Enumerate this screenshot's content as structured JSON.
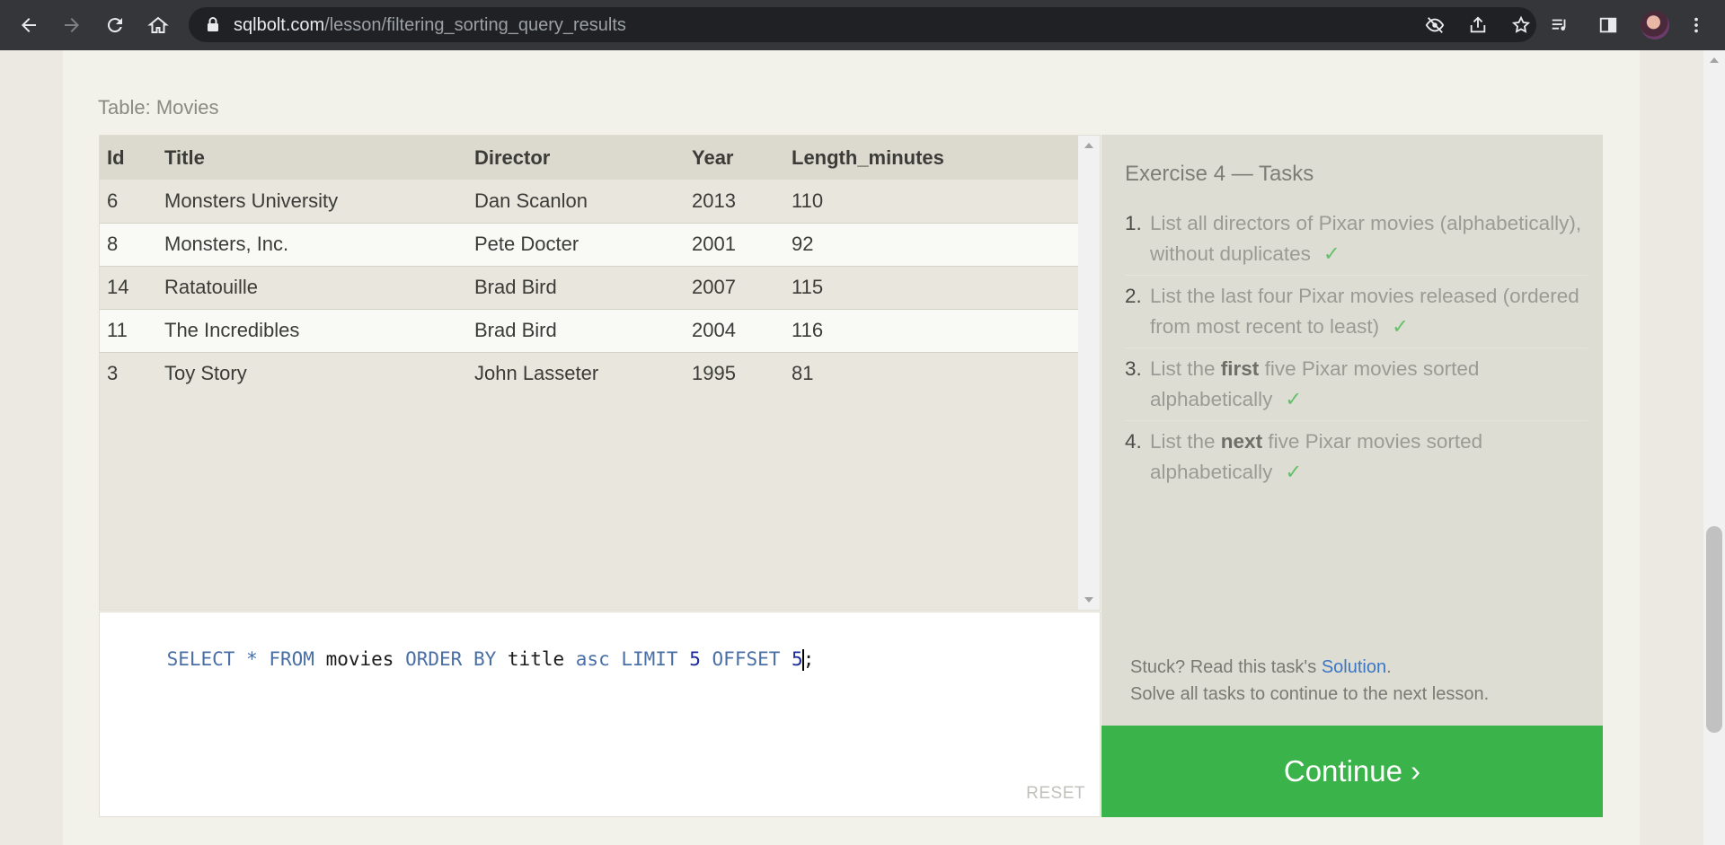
{
  "browser": {
    "url_host": "sqlbolt.com",
    "url_path": "/lesson/filtering_sorting_query_results"
  },
  "table": {
    "caption": "Table: Movies",
    "columns": [
      "Id",
      "Title",
      "Director",
      "Year",
      "Length_minutes"
    ],
    "rows": [
      [
        "6",
        "Monsters University",
        "Dan Scanlon",
        "2013",
        "110"
      ],
      [
        "8",
        "Monsters, Inc.",
        "Pete Docter",
        "2001",
        "92"
      ],
      [
        "14",
        "Ratatouille",
        "Brad Bird",
        "2007",
        "115"
      ],
      [
        "11",
        "The Incredibles",
        "Brad Bird",
        "2004",
        "116"
      ],
      [
        "3",
        "Toy Story",
        "John Lasseter",
        "1995",
        "81"
      ]
    ]
  },
  "editor": {
    "tokens": [
      {
        "t": "SELECT",
        "c": "kw"
      },
      {
        "t": " * ",
        "c": "punc"
      },
      {
        "t": "FROM",
        "c": "kw"
      },
      {
        "t": " movies ",
        "c": "id"
      },
      {
        "t": "ORDER BY",
        "c": "kw"
      },
      {
        "t": " title ",
        "c": "id"
      },
      {
        "t": "asc",
        "c": "kw"
      },
      {
        "t": " LIMIT ",
        "c": "kw"
      },
      {
        "t": "5",
        "c": "num"
      },
      {
        "t": " OFFSET ",
        "c": "kw"
      },
      {
        "t": "5",
        "c": "num"
      },
      {
        "t": ";",
        "c": "id"
      }
    ],
    "reset_label": "RESET"
  },
  "exercise": {
    "title": "Exercise 4 — Tasks",
    "tasks": [
      {
        "num": "1.",
        "parts": [
          "List all directors of Pixar movies (alphabetically), without duplicates"
        ],
        "bold": "",
        "done": "✓"
      },
      {
        "num": "2.",
        "parts": [
          "List the last four Pixar movies released (ordered from most recent to least)"
        ],
        "bold": "",
        "done": "✓"
      },
      {
        "num": "3.",
        "before": "List the ",
        "bold": "first",
        "after": " five Pixar movies sorted alphabetically",
        "done": "✓"
      },
      {
        "num": "4.",
        "before": "List the ",
        "bold": "next",
        "after": " five Pixar movies sorted alphabetically",
        "done": "✓"
      }
    ],
    "stuck_prefix": "Stuck? Read this task's ",
    "solution_link": "Solution",
    "stuck_suffix": ".",
    "stuck_line2": "Solve all tasks to continue to the next lesson.",
    "continue_label": "Continue ›"
  },
  "colors": {
    "continue_bg": "#3ab44a",
    "check": "#63c06b",
    "sql_keyword": "#4a6fa5",
    "sql_number": "#1c2a9a"
  }
}
